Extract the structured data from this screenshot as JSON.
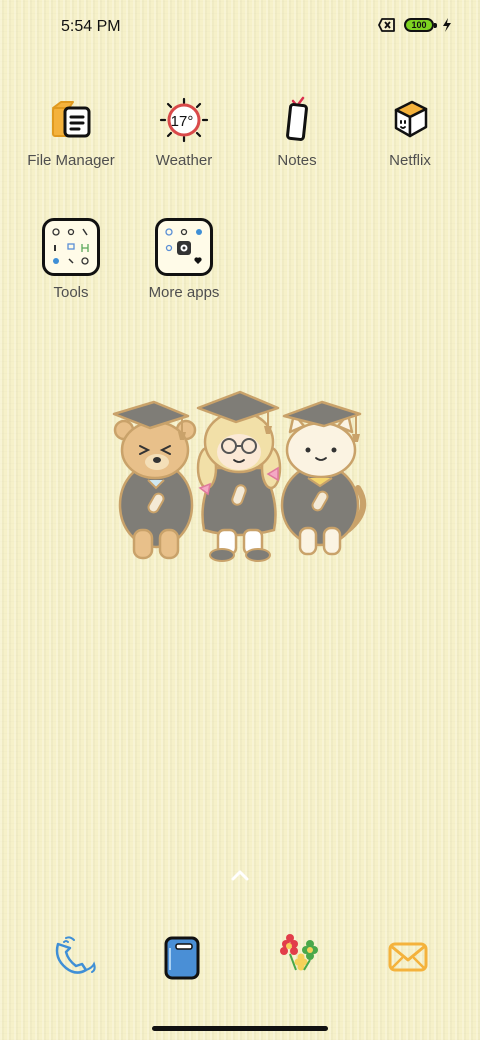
{
  "status_bar": {
    "time": "5:54 PM",
    "battery_level": "100"
  },
  "apps": [
    {
      "label": "File Manager",
      "icon": "file-manager-icon"
    },
    {
      "label": "Weather",
      "icon": "weather-sun-icon",
      "temperature": "17°"
    },
    {
      "label": "Notes",
      "icon": "notes-icon"
    },
    {
      "label": "Netflix",
      "icon": "netflix-box-icon"
    }
  ],
  "folders": [
    {
      "label": "Tools",
      "icon": "tools-folder-icon"
    },
    {
      "label": "More apps",
      "icon": "more-apps-folder-icon"
    }
  ],
  "dock": [
    {
      "name": "phone",
      "icon": "phone-icon"
    },
    {
      "name": "notebook",
      "icon": "notebook-icon"
    },
    {
      "name": "gallery",
      "icon": "flowers-icon"
    },
    {
      "name": "messages",
      "icon": "envelope-icon"
    }
  ],
  "colors": {
    "background": "#f6f1c9",
    "label": "#4f4f4f",
    "battery": "#7ed321"
  }
}
